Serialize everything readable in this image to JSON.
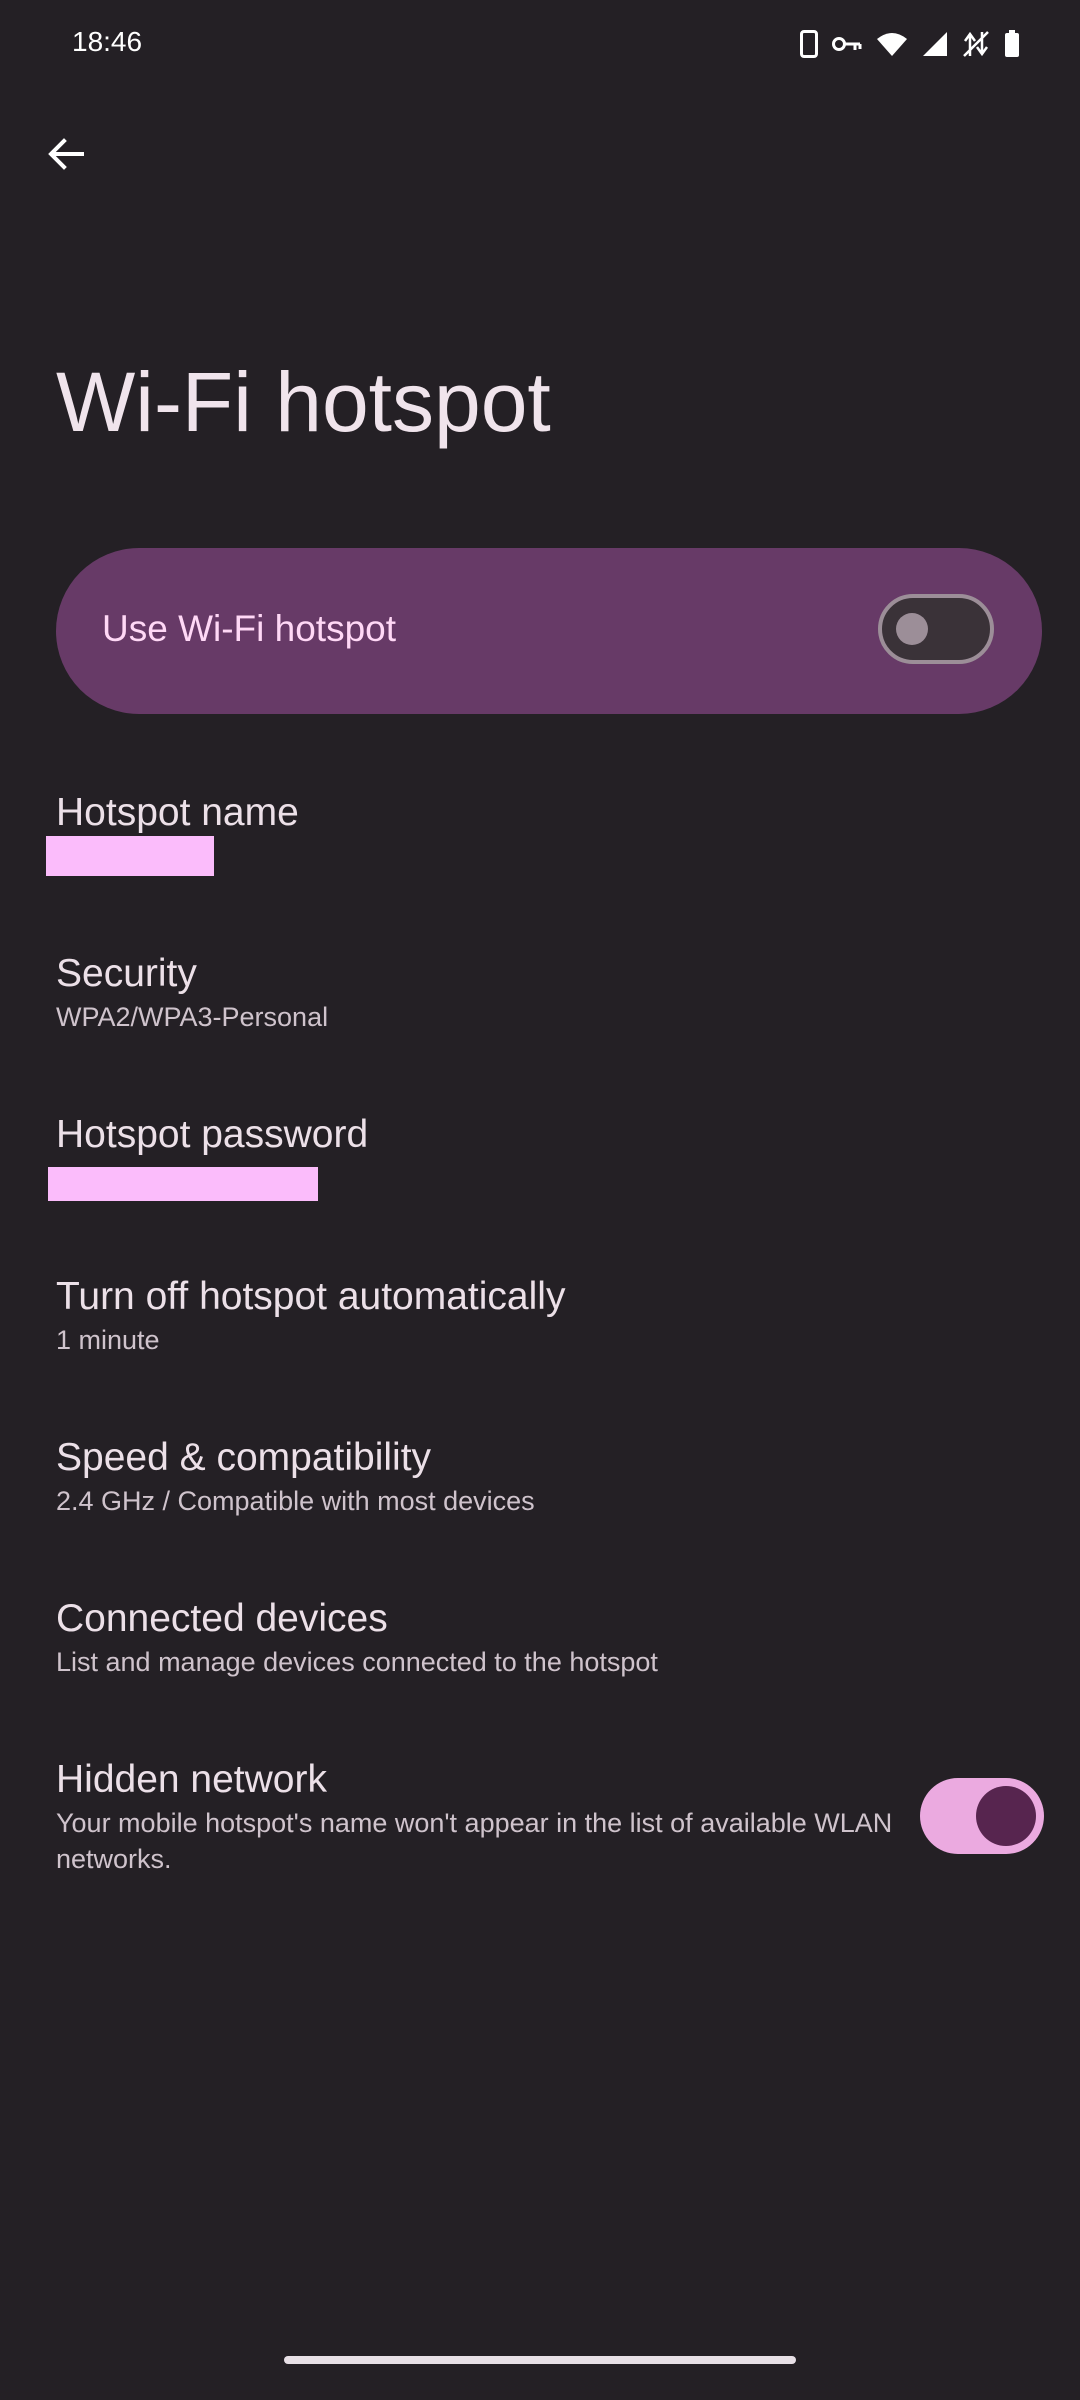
{
  "status_bar": {
    "time": "18:46",
    "icons": [
      "phone-icon",
      "vpn-key-icon",
      "wifi-icon",
      "cell-signal-icon",
      "no-data-icon",
      "battery-icon"
    ]
  },
  "header": {
    "back_icon": "arrow-left-icon",
    "title": "Wi-Fi hotspot"
  },
  "main_toggle": {
    "label": "Use Wi-Fi hotspot",
    "checked": false
  },
  "settings": [
    {
      "title": "Hotspot name",
      "summary": ""
    },
    {
      "title": "Security",
      "summary": "WPA2/WPA3-Personal"
    },
    {
      "title": "Hotspot password",
      "summary": ""
    },
    {
      "title": "Turn off hotspot automatically",
      "summary": "1 minute"
    },
    {
      "title": "Speed & compatibility",
      "summary": "2.4 GHz / Compatible with most devices"
    },
    {
      "title": "Connected devices",
      "summary": "List and manage devices connected to the hotspot"
    },
    {
      "title": "Hidden network",
      "summary": "Your mobile hotspot's name won't appear in the list of available WLAN networks.",
      "checked": true
    }
  ],
  "colors": {
    "background": "#242025",
    "card": "#673a67",
    "accent": "#ebaae0",
    "redaction": "#fbbcfb"
  }
}
